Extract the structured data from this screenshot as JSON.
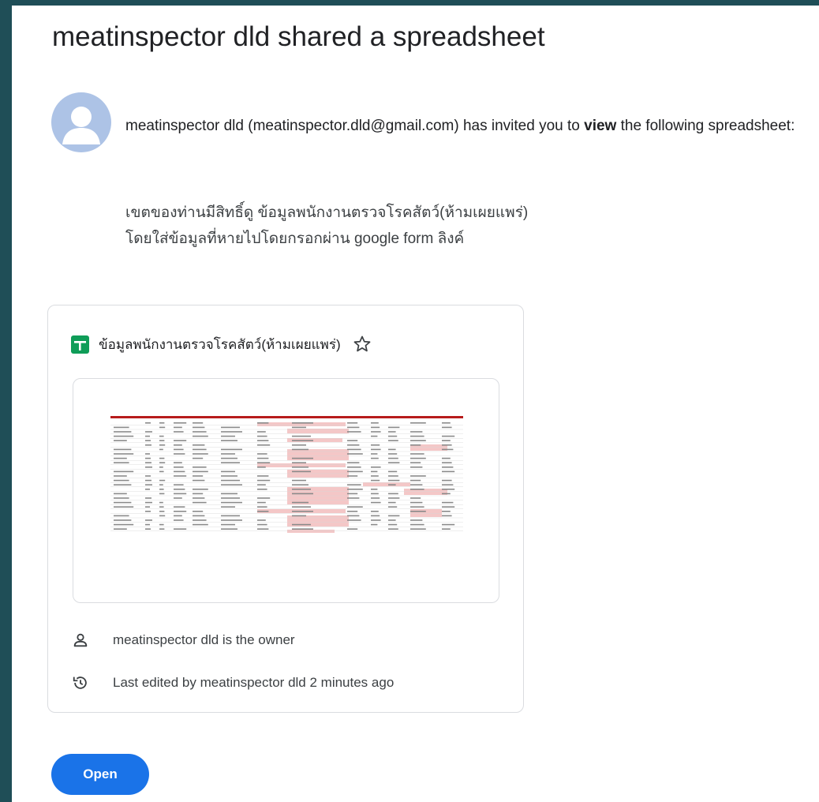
{
  "email": {
    "title": "meatinspector dld shared a spreadsheet",
    "invite": {
      "text_before": "meatinspector dld (meatinspector.dld@gmail.com) has invited you to ",
      "permission": "view",
      "text_after": " the following spreadsheet:"
    },
    "message_lines": [
      "เขตของท่านมีสิทธิ์ดู ข้อมูลพนักงานตรวจโรคสัตว์(ห้ามเผยแพร่)",
      "โดยใส่ข้อมูลที่หายไปโดยกรอกผ่าน google form ลิงค์"
    ]
  },
  "card": {
    "doc_title": "ข้อมูลพนักงานตรวจโรคสัตว์(ห้ามเผยแพร่)",
    "owner_text": "meatinspector dld is the owner",
    "last_edited_text": "Last edited by meatinspector dld 2 minutes ago"
  },
  "actions": {
    "open_label": "Open"
  },
  "icons": {
    "sheets": "google-sheets-icon",
    "star": "star-icon",
    "owner": "person-icon",
    "history": "history-icon",
    "avatar": "default-avatar"
  },
  "colors": {
    "page_frame": "#1f4e57",
    "primary_button": "#1a73e8",
    "sheets_green": "#0f9d58",
    "avatar_bg": "#adc3e6",
    "thumb_header": "#b71c1c",
    "thumb_highlight": "#f4c7c7"
  }
}
